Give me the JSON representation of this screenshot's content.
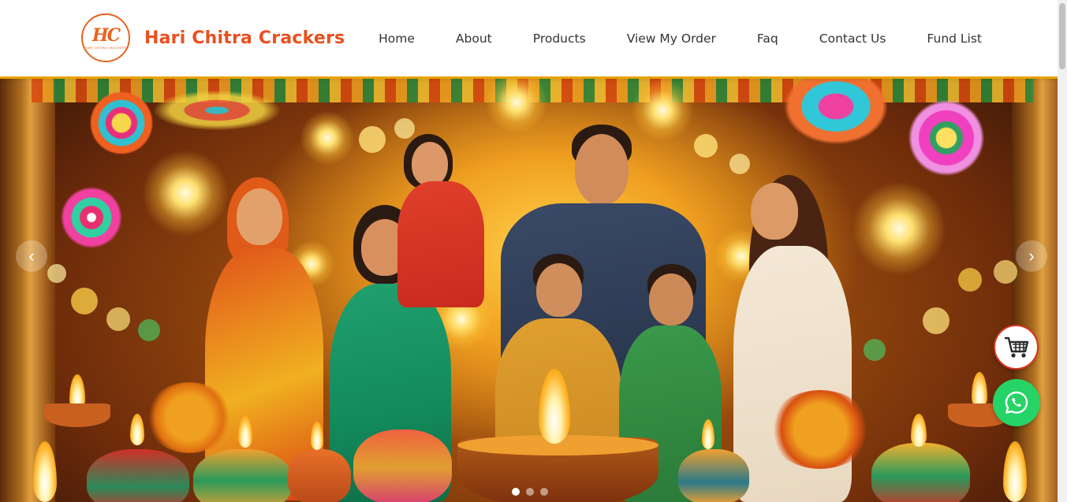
{
  "brand": {
    "logo_monogram": "HC",
    "logo_tagline": "HARI CHITRA CRACKERS",
    "name": "Hari Chitra Crackers",
    "accent_color": "#e8501f"
  },
  "nav": {
    "items": [
      {
        "label": "Home"
      },
      {
        "label": "About"
      },
      {
        "label": "Products"
      },
      {
        "label": "View My Order"
      },
      {
        "label": "Faq"
      },
      {
        "label": "Contact Us"
      },
      {
        "label": "Fund List"
      }
    ]
  },
  "hero": {
    "image_subject": "diwali-family-celebration",
    "prev_icon": "chevron-left-icon",
    "next_icon": "chevron-right-icon",
    "prev_glyph": "‹",
    "next_glyph": "›",
    "slide_count": 3,
    "active_slide": 1
  },
  "floating": {
    "cart_icon": "shopping-cart-icon",
    "whatsapp_icon": "whatsapp-icon",
    "cart_color": "#d9341f",
    "whatsapp_color": "#25d366"
  }
}
